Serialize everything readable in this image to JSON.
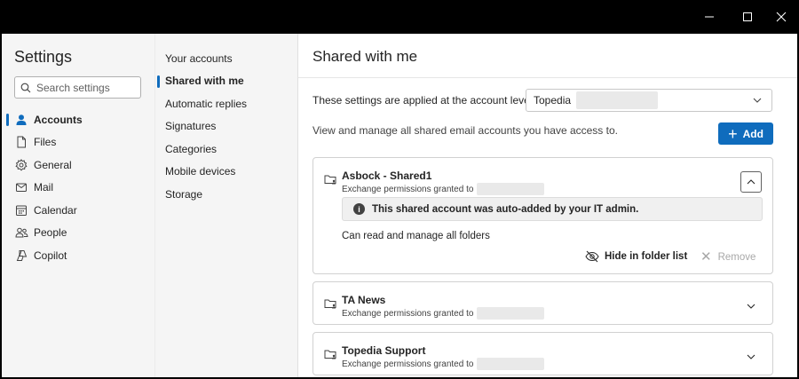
{
  "window": {
    "minimize_icon": "minimize-icon",
    "maximize_icon": "maximize-icon",
    "close_icon": "close-icon"
  },
  "sidebar": {
    "title": "Settings",
    "search_placeholder": "Search settings",
    "items": [
      {
        "label": "Accounts",
        "icon": "person-icon",
        "active": true
      },
      {
        "label": "Files",
        "icon": "file-icon",
        "active": false
      },
      {
        "label": "General",
        "icon": "gear-icon",
        "active": false
      },
      {
        "label": "Mail",
        "icon": "mail-icon",
        "active": false
      },
      {
        "label": "Calendar",
        "icon": "calendar-icon",
        "active": false
      },
      {
        "label": "People",
        "icon": "people-icon",
        "active": false
      },
      {
        "label": "Copilot",
        "icon": "copilot-icon",
        "active": false
      }
    ]
  },
  "subnav": {
    "items": [
      {
        "label": "Your accounts",
        "active": false
      },
      {
        "label": "Shared with me",
        "active": true
      },
      {
        "label": "Automatic replies",
        "active": false
      },
      {
        "label": "Signatures",
        "active": false
      },
      {
        "label": "Categories",
        "active": false
      },
      {
        "label": "Mobile devices",
        "active": false
      },
      {
        "label": "Storage",
        "active": false
      }
    ]
  },
  "main": {
    "title": "Shared with me",
    "account_level_label": "These settings are applied at the account level:",
    "account_selected": "Topedia",
    "description": "View and manage all shared email accounts you have access to.",
    "add_label": "Add",
    "accent": "#0f6cbd",
    "shared_accounts": [
      {
        "name": "Asbock - Shared1",
        "permissions": "Exchange permissions granted to",
        "expanded": true,
        "notice": "This shared account was auto-added by your IT admin.",
        "access": "Can read and manage all folders",
        "hide_label": "Hide in folder list",
        "remove_label": "Remove"
      },
      {
        "name": "TA News",
        "permissions": "Exchange permissions granted to",
        "expanded": false
      },
      {
        "name": "Topedia Support",
        "permissions": "Exchange permissions granted to",
        "expanded": false
      }
    ]
  }
}
